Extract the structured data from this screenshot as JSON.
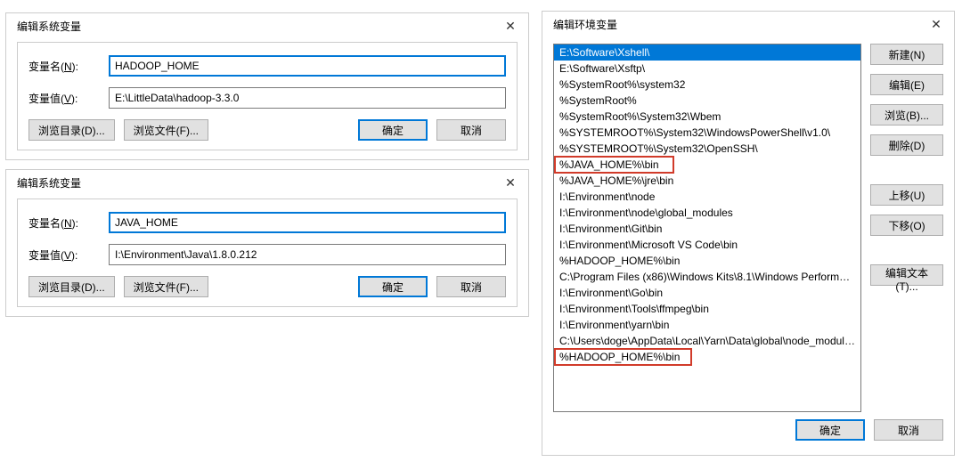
{
  "dlg1": {
    "title": "编辑系统变量",
    "name_label_pre": "变量名(",
    "name_label_u": "N",
    "name_label_post": "):",
    "value_label_pre": "变量值(",
    "value_label_u": "V",
    "value_label_post": "):",
    "name_value": "HADOOP_HOME",
    "value_value": "E:\\LittleData\\hadoop-3.3.0",
    "browse_dir": "浏览目录(D)...",
    "browse_file": "浏览文件(F)...",
    "ok": "确定",
    "cancel": "取消"
  },
  "dlg2": {
    "title": "编辑系统变量",
    "name_value": "JAVA_HOME",
    "value_value": "I:\\Environment\\Java\\1.8.0.212",
    "browse_dir": "浏览目录(D)...",
    "browse_file": "浏览文件(F)...",
    "ok": "确定",
    "cancel": "取消"
  },
  "dlg3": {
    "title": "编辑环境变量",
    "items": [
      "E:\\Software\\Xshell\\",
      "E:\\Software\\Xsftp\\",
      "%SystemRoot%\\system32",
      "%SystemRoot%",
      "%SystemRoot%\\System32\\Wbem",
      "%SYSTEMROOT%\\System32\\WindowsPowerShell\\v1.0\\",
      "%SYSTEMROOT%\\System32\\OpenSSH\\",
      "%JAVA_HOME%\\bin",
      "%JAVA_HOME%\\jre\\bin",
      "I:\\Environment\\node",
      "I:\\Environment\\node\\global_modules",
      "I:\\Environment\\Git\\bin",
      "I:\\Environment\\Microsoft VS Code\\bin",
      "%HADOOP_HOME%\\bin",
      "C:\\Program Files (x86)\\Windows Kits\\8.1\\Windows Performance...",
      "I:\\Environment\\Go\\bin",
      "I:\\Environment\\Tools\\ffmpeg\\bin",
      "I:\\Environment\\yarn\\bin",
      "C:\\Users\\doge\\AppData\\Local\\Yarn\\Data\\global\\node_modules...",
      "%HADOOP_HOME%\\bin"
    ],
    "btn_new": "新建(N)",
    "btn_edit": "编辑(E)",
    "btn_browse": "浏览(B)...",
    "btn_delete": "删除(D)",
    "btn_up": "上移(U)",
    "btn_down": "下移(O)",
    "btn_edit_text": "编辑文本(T)...",
    "ok": "确定",
    "cancel": "取消"
  }
}
